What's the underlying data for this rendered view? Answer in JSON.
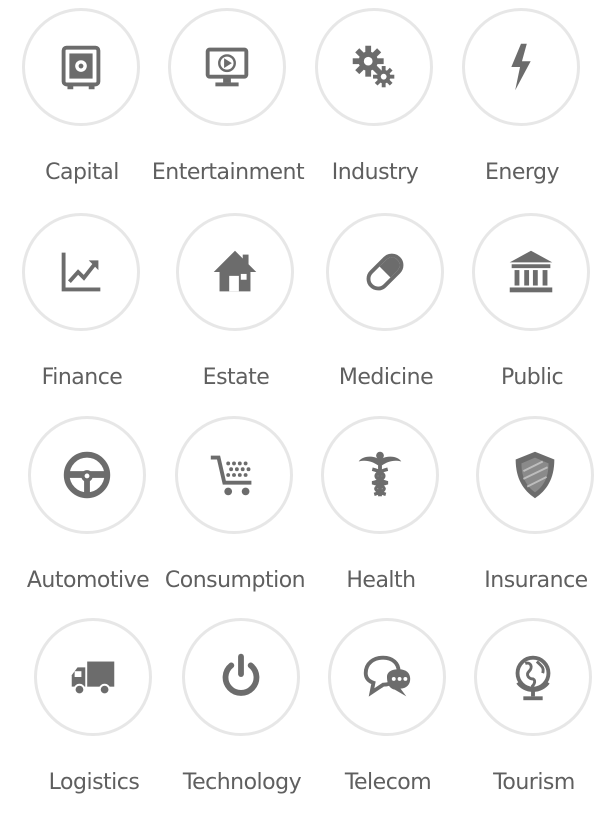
{
  "categories": [
    {
      "label": "Capital",
      "icon": "safe-icon"
    },
    {
      "label": "Entertainment",
      "icon": "monitor-play-icon"
    },
    {
      "label": "Industry",
      "icon": "gears-icon"
    },
    {
      "label": "Energy",
      "icon": "lightning-icon"
    },
    {
      "label": "Finance",
      "icon": "chart-trend-icon"
    },
    {
      "label": "Estate",
      "icon": "house-icon"
    },
    {
      "label": "Medicine",
      "icon": "pill-icon"
    },
    {
      "label": "Public",
      "icon": "government-building-icon"
    },
    {
      "label": "Automotive",
      "icon": "steering-wheel-icon"
    },
    {
      "label": "Consumption",
      "icon": "shopping-cart-icon"
    },
    {
      "label": "Health",
      "icon": "caduceus-icon"
    },
    {
      "label": "Insurance",
      "icon": "shield-icon"
    },
    {
      "label": "Logistics",
      "icon": "truck-icon"
    },
    {
      "label": "Technology",
      "icon": "power-icon"
    },
    {
      "label": "Telecom",
      "icon": "chat-bubbles-icon"
    },
    {
      "label": "Tourism",
      "icon": "globe-icon"
    }
  ],
  "colors": {
    "icon": "#6c6c6c",
    "circle_border": "#e7e7e7",
    "label": "#5f5f5f"
  }
}
